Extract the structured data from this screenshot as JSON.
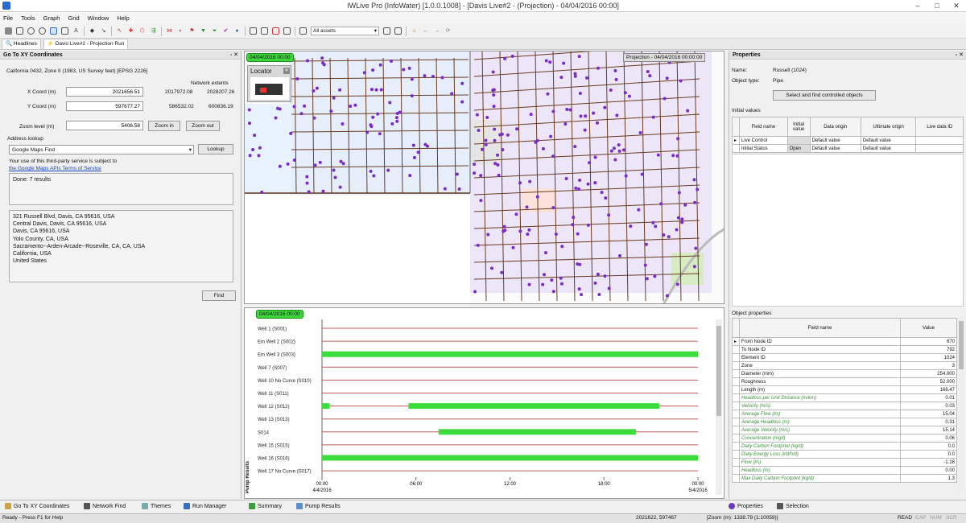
{
  "window": {
    "title": "IWLive Pro (InfoWater) [1.0.0.1008] - [Davis Live#2 - (Projection) - 04/04/2016 00:00]"
  },
  "menu": [
    "File",
    "Tools",
    "Graph",
    "Grid",
    "Window",
    "Help"
  ],
  "toolbar": {
    "asset_filter": "All assets"
  },
  "doc_tabs": [
    "Headlines",
    "Davis Live#2 - Projection Run"
  ],
  "goto": {
    "title": "Go To XY Coordinates",
    "projection": "California 0432, Zone II (1983, US Survey feet) [EPSG 2226]",
    "extents_label": "Network extents",
    "x_label": "X Coord (m)",
    "x_value": "2021656.51",
    "y_label": "Y Coord (m)",
    "y_value": "597677.27",
    "ext_x_min": "2017972.08",
    "ext_x_max": "2028207.26",
    "ext_y_min": "586532.02",
    "ext_y_max": "600836.19",
    "zoom_label": "Zoom level (m)",
    "zoom_value": "5406.58",
    "zoom_in": "Zoom in",
    "zoom_out": "Zoom out",
    "address_label": "Address lookup",
    "address_provider": "Google Maps Find",
    "lookup": "Lookup",
    "notice": "Your use of this third-party service is subject to",
    "terms_link": "the Google Maps APIs Terms of Service",
    "status": "Done: 7 results",
    "results": [
      "321 Russell Blvd, Davis, CA 95616, USA",
      "Central Davis, Davis, CA 95616, USA",
      "Davis, CA 95616, USA",
      "Yolo County, CA, USA",
      "Sacramento--Arden-Arcade--Roseville, CA, CA, USA",
      "California, USA",
      "United States"
    ],
    "find": "Find"
  },
  "map": {
    "time_tag": "04/04/2016 00:00",
    "projection_tag": "Projection - 04/04/2016 00:00:00",
    "locator": "Locator"
  },
  "timeline": {
    "time_tag": "04/04/2016 00:00",
    "vertical_label": "Pump Results",
    "rows": [
      "Well 1 (S001)",
      "Em Well 2 (S002)",
      "Em Well 3 (S003)",
      "Well 7 (S007)",
      "Well 10 No Curve (S010)",
      "Well 11 (S011)",
      "Well 12 (S012)",
      "Well 13 (S013)",
      "S014",
      "Well 15 (S015)",
      "Well 16 (S016)",
      "Well 17 No Curve (S017)"
    ],
    "ticks": [
      {
        "time": "00:00",
        "date": "4/4/2016"
      },
      {
        "time": "06:00",
        "date": ""
      },
      {
        "time": "12:00",
        "date": ""
      },
      {
        "time": "18:00",
        "date": ""
      },
      {
        "time": "00:00",
        "date": "5/4/2016"
      }
    ],
    "on_segments": [
      {
        "row": 2,
        "start": 0,
        "end": 1
      },
      {
        "row": 6,
        "start": 0,
        "end": 0.02
      },
      {
        "row": 6,
        "start": 0.23,
        "end": 0.897
      },
      {
        "row": 8,
        "start": 0.31,
        "end": 0.835
      },
      {
        "row": 10,
        "start": 0,
        "end": 1
      }
    ]
  },
  "properties": {
    "title": "Properties",
    "name_label": "Name:",
    "name": "Russell (1024)",
    "type_label": "Object type:",
    "type": "Pipe",
    "select_button": "Select and find controlled objects",
    "initial_values_label": "Initial values",
    "iv_headers": [
      "Field name",
      "Initial value",
      "Data origin",
      "Ultimate origin",
      "Live data ID"
    ],
    "iv_rows": [
      [
        "Live Control",
        "",
        "Default value",
        "Default value",
        ""
      ],
      [
        "Initial Status",
        "Open",
        "Default value",
        "Default value",
        ""
      ]
    ],
    "object_props_label": "Object properties",
    "op_headers": [
      "Field name",
      "Value"
    ],
    "op_rows": [
      {
        "name": "From Node ID",
        "value": "670",
        "result": false
      },
      {
        "name": "To Node ID",
        "value": "792",
        "result": false
      },
      {
        "name": "Element ID",
        "value": "1024",
        "result": false
      },
      {
        "name": "Zone",
        "value": "3",
        "result": false
      },
      {
        "name": "Diameter (mm)",
        "value": "254.000",
        "result": false
      },
      {
        "name": "Roughness",
        "value": "52.000",
        "result": false
      },
      {
        "name": "Length (m)",
        "value": "168.47",
        "result": false
      },
      {
        "name": "Headloss per Unit Distance (m/km)",
        "value": "0.01",
        "result": true
      },
      {
        "name": "Velocity (m/s)",
        "value": "0.03",
        "result": true
      },
      {
        "name": "Average Flow (l/s)",
        "value": "15.04",
        "result": true
      },
      {
        "name": "Average Headloss (m)",
        "value": "0.31",
        "result": true
      },
      {
        "name": "Average Velocity (m/s)",
        "value": "15.14",
        "result": true
      },
      {
        "name": "Concentration (mg/l)",
        "value": "0.06",
        "result": true
      },
      {
        "name": "Daily Carbon Footprint (kg/d)",
        "value": "0.0",
        "result": true
      },
      {
        "name": "Daily Energy Loss (kWh/d)",
        "value": "0.0",
        "result": true
      },
      {
        "name": "Flow (l/s)",
        "value": "-1.28",
        "result": true
      },
      {
        "name": "Headloss (m)",
        "value": "0.00",
        "result": true
      },
      {
        "name": "Max Daily Carbon Footprint (kg/d)",
        "value": "1.3",
        "result": true
      }
    ]
  },
  "bottom_tabs_left": [
    "Go To XY Coordinates",
    "Network Find",
    "Themes",
    "Run Manager",
    "Summary",
    "Pump Results"
  ],
  "bottom_tabs_right": [
    "Properties",
    "Selection"
  ],
  "status": {
    "ready": "Ready - Press F1 for Help",
    "coords": "2021622, 597467",
    "zoom": "[Zoom (m): 1338.79 (1:10059)]",
    "flags": [
      "READ",
      "CAP",
      "NUM",
      "SCR"
    ]
  },
  "colors": {
    "pump_on": "#3ddc3d",
    "pump_off": "#c05a5a",
    "node": "#7a2bc8",
    "pipe": "#6b3b1e"
  }
}
